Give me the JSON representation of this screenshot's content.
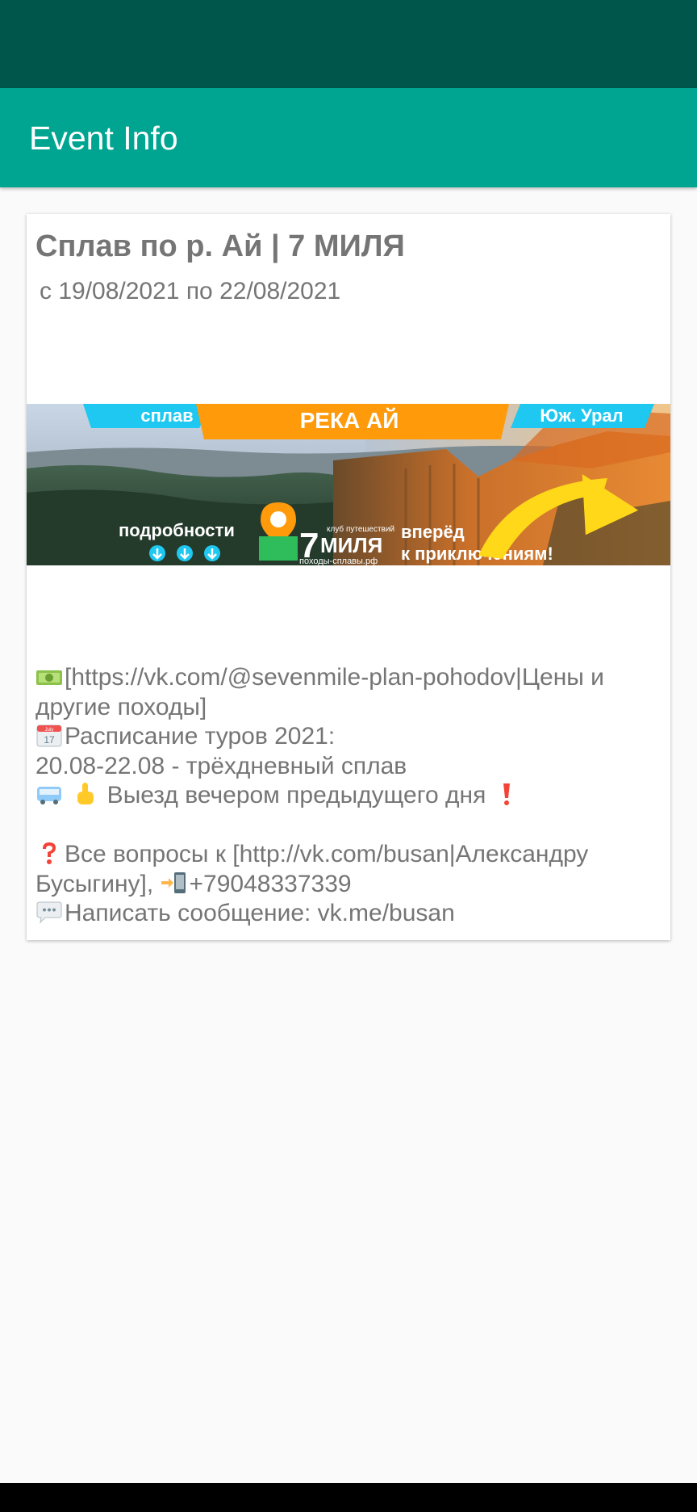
{
  "app_bar": {
    "title": "Event Info"
  },
  "event": {
    "title": "Сплав по р. Ай  | 7 МИЛЯ",
    "dates": "с 19/08/2021 по 22/08/2021"
  },
  "banner": {
    "tag_left": "сплав",
    "tag_center": "РЕКА АЙ",
    "tag_right": "Юж. Урал",
    "details_label": "подробности",
    "logo_number": "7",
    "logo_word": "МИЛЯ",
    "logo_club": "клуб путешествий",
    "logo_site": "походы-сплавы.рф",
    "slogan_line1": "вперёд",
    "slogan_line2": "к приключениям!"
  },
  "description": {
    "line1": "[https://vk.com/@sevenmile-plan-pohodov|Цены и",
    "line2": "другие походы]",
    "line3": "Расписание туров 2021:",
    "line4": "20.08-22.08 - трёхдневный сплав",
    "line5": " Выезд вечером предыдущего дня ",
    "line7": "Все вопросы к [http://vk.com/busan|Александру",
    "line8a": "Бусыгину], ",
    "line8b": "+79048337339",
    "line9": "Написать сообщение: vk.me/busan",
    "calendar_month": "July",
    "calendar_day": "17"
  },
  "icons": [
    "money-icon",
    "calendar-icon",
    "bus-icon",
    "pointing-finger-icon",
    "exclamation-icon",
    "question-icon",
    "phone-icon",
    "speech-bubble-icon",
    "down-arrow-icon"
  ],
  "colors": {
    "status_bar": "#00564b",
    "app_bar": "#00a591",
    "background": "#fafafa",
    "text_gray": "#757575",
    "banner_orange": "#ff9a0a",
    "banner_cyan": "#1ec8f0"
  }
}
